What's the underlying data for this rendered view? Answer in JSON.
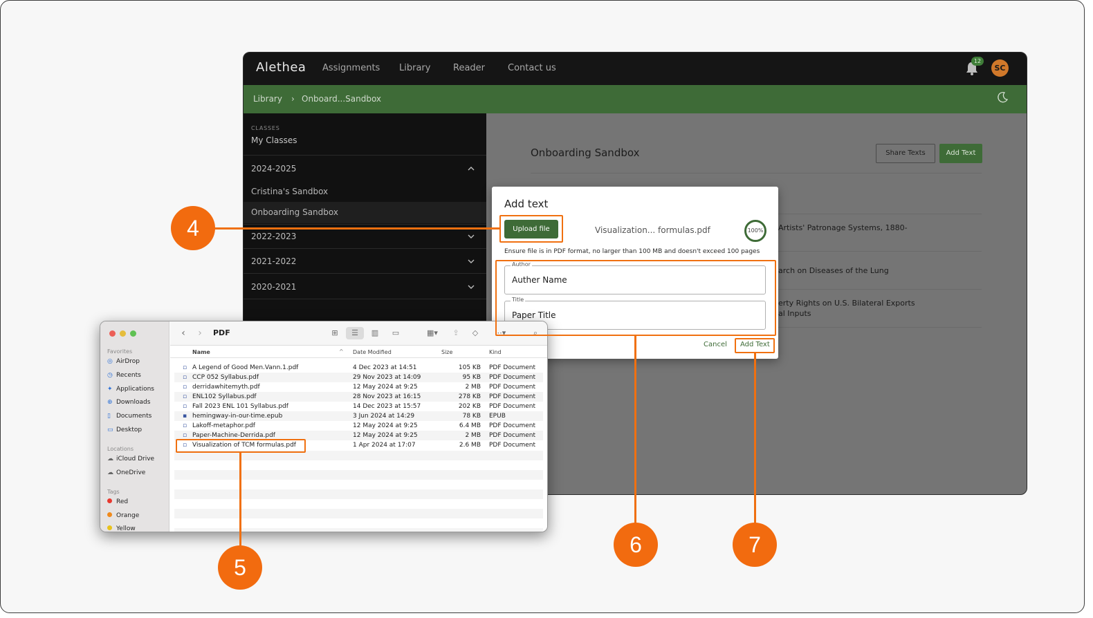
{
  "app": {
    "brand": "Alethea",
    "nav": [
      "Assignments",
      "Library",
      "Reader",
      "Contact us"
    ],
    "notification_count": "12",
    "avatar_initials": "SC",
    "breadcrumb": [
      "Library",
      "›",
      "Onboard...Sandbox"
    ],
    "sidebar": {
      "caption": "CLASSES",
      "my_classes": "My Classes",
      "year_2024": "2024-2025",
      "items_2024": [
        "Cristina's Sandbox",
        "Onboarding Sandbox"
      ],
      "year_2022": "2022-2023",
      "year_2021": "2021-2022",
      "year_2020": "2020-2021"
    },
    "main": {
      "title": "Onboarding Sandbox",
      "share_label": "Share Texts",
      "add_label": "Add Text",
      "docs": [
        "Artists' Patronage Systems, 1880-",
        "arch on Diseases of the Lung",
        "erty Rights on U.S. Bilateral Exports",
        "al Inputs"
      ]
    }
  },
  "dialog": {
    "title": "Add text",
    "upload_label": "Upload file",
    "filename": "Visualization... formulas.pdf",
    "progress": "100%",
    "hint": "Ensure file is in PDF format, no larger than 100 MB and doesn't exceed 100 pages",
    "author_label": "Author",
    "author_value": "Auther Name",
    "title_label": "Title",
    "title_value": "Paper Title",
    "cancel_label": "Cancel",
    "add_label": "Add Text"
  },
  "finder": {
    "folder": "PDF",
    "favorites_label": "Favorites",
    "favorites": [
      "AirDrop",
      "Recents",
      "Applications",
      "Downloads",
      "Documents",
      "Desktop"
    ],
    "locations_label": "Locations",
    "locations": [
      "iCloud Drive",
      "OneDrive"
    ],
    "tags_label": "Tags",
    "tags": [
      "Red",
      "Orange",
      "Yellow"
    ],
    "tag_colors": [
      "#e8392f",
      "#f08a1c",
      "#e8c21c"
    ],
    "columns": [
      "Name",
      "Date Modified",
      "Size",
      "Kind"
    ],
    "files": [
      {
        "name": "A Legend of Good Men.Vann.1.pdf",
        "date": "4 Dec 2023 at 14:51",
        "size": "105 KB",
        "kind": "PDF Document"
      },
      {
        "name": "CCP 052 Syllabus.pdf",
        "date": "29 Nov 2023 at 14:09",
        "size": "95 KB",
        "kind": "PDF Document"
      },
      {
        "name": "derridawhitemyth.pdf",
        "date": "12 May 2024 at 9:25",
        "size": "2 MB",
        "kind": "PDF Document"
      },
      {
        "name": "ENL102 Syllabus.pdf",
        "date": "28 Nov 2023 at 16:15",
        "size": "278 KB",
        "kind": "PDF Document"
      },
      {
        "name": "Fall 2023 ENL 101 Syllabus.pdf",
        "date": "14 Dec 2023 at 15:57",
        "size": "202 KB",
        "kind": "PDF Document"
      },
      {
        "name": "hemingway-in-our-time.epub",
        "date": "3 Jun 2024 at 14:29",
        "size": "78 KB",
        "kind": "EPUB"
      },
      {
        "name": "Lakoff-metaphor.pdf",
        "date": "12 May 2024 at 9:25",
        "size": "6.4 MB",
        "kind": "PDF Document"
      },
      {
        "name": "Paper-Machine-Derrida.pdf",
        "date": "12 May 2024 at 9:25",
        "size": "2 MB",
        "kind": "PDF Document"
      },
      {
        "name": "Visualization of TCM formulas.pdf",
        "date": "1 Apr 2024 at 17:07",
        "size": "2.6 MB",
        "kind": "PDF Document"
      }
    ]
  },
  "annotations": [
    "4",
    "5",
    "6",
    "7"
  ],
  "annotation_color": "#f07010"
}
